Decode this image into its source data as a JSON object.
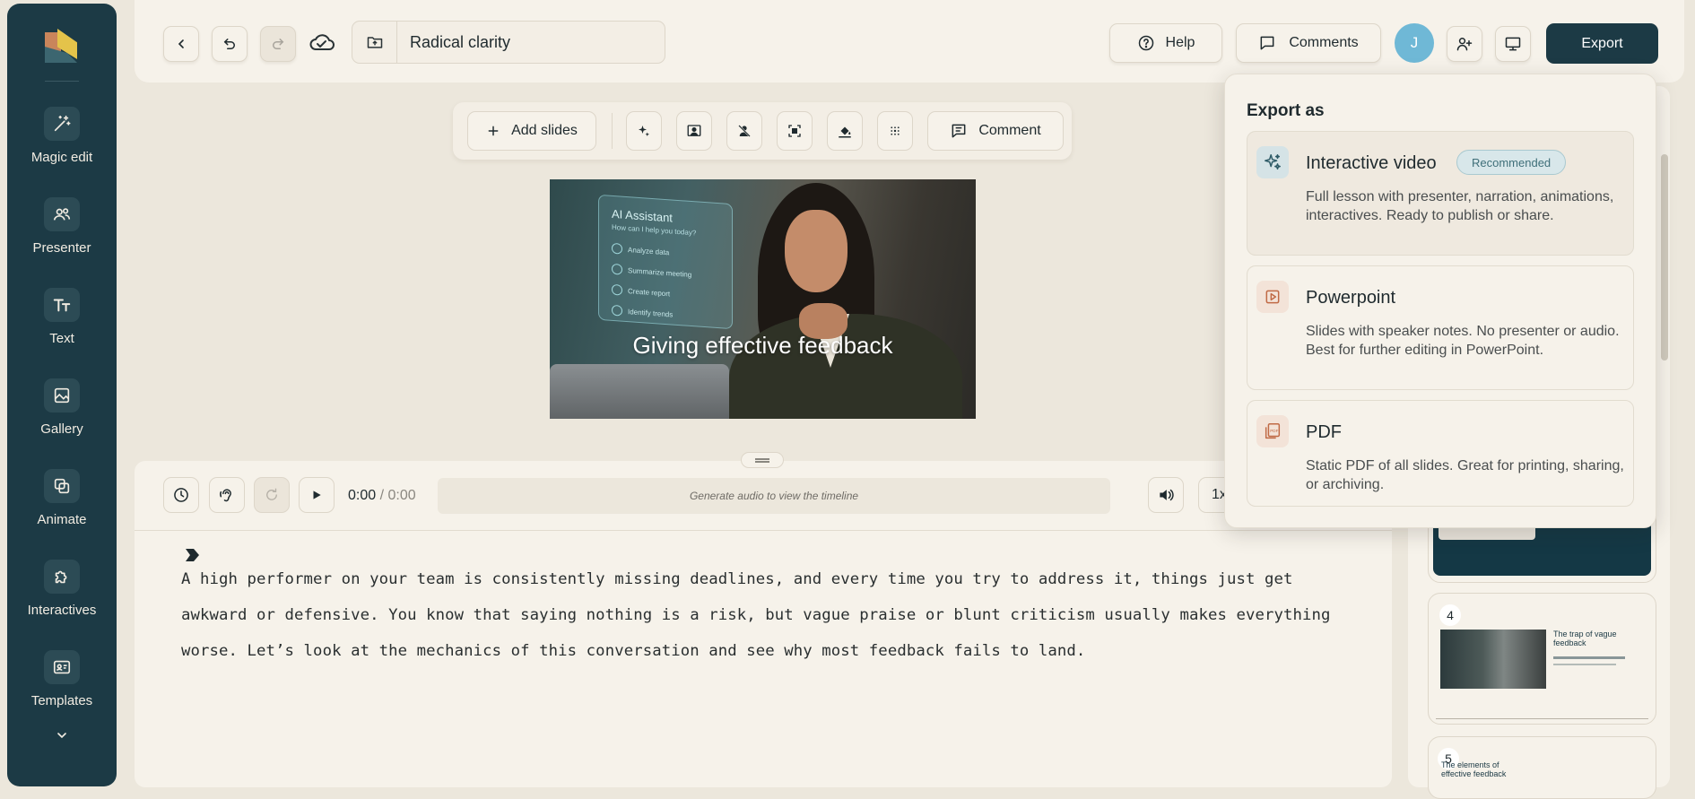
{
  "sidebar": {
    "items": [
      {
        "label": "Magic edit",
        "icon": "magic-wand-icon"
      },
      {
        "label": "Presenter",
        "icon": "people-icon"
      },
      {
        "label": "Text",
        "icon": "text-icon"
      },
      {
        "label": "Gallery",
        "icon": "image-icon"
      },
      {
        "label": "Animate",
        "icon": "layers-icon"
      },
      {
        "label": "Interactives",
        "icon": "puzzle-icon"
      },
      {
        "label": "Templates",
        "icon": "template-icon"
      }
    ]
  },
  "header": {
    "title": "Radical clarity",
    "help_label": "Help",
    "comments_label": "Comments",
    "avatar_initial": "J",
    "export_label": "Export"
  },
  "slide_toolbar": {
    "add_slides_label": "Add slides",
    "comment_label": "Comment"
  },
  "slide": {
    "title": "Giving effective feedback",
    "panel_title": "AI Assistant",
    "panel_subtitle": "How can I help you today?",
    "panel_items": [
      "Analyze data",
      "Summarize meeting",
      "Create report",
      "Identify trends"
    ]
  },
  "player": {
    "current_time": "0:00",
    "total_time": "/ 0:00",
    "timeline_placeholder": "Generate audio to view the timeline",
    "speed": "1x"
  },
  "script": {
    "text": "A high performer on your team is consistently missing deadlines, and every time you try to address it, things just get awkward or defensive. You know that saying nothing is a risk, but vague praise or blunt criticism usually makes everything worse. Let’s look at the mechanics of this conversation and see why most feedback fails to land."
  },
  "slide_panel": {
    "thumbs": [
      {
        "number": "4",
        "title": "The trap of vague feedback"
      },
      {
        "number": "5",
        "title": "The elements of effective feedback"
      }
    ]
  },
  "export_menu": {
    "heading": "Export as",
    "options": [
      {
        "title": "Interactive video",
        "badge": "Recommended",
        "description": "Full lesson with presenter, narration, animations, interactives. Ready to publish or share."
      },
      {
        "title": "Powerpoint",
        "description": "Slides with speaker notes. No presenter or audio. Best for further editing in PowerPoint."
      },
      {
        "title": "PDF",
        "description": "Static PDF of all slides. Great for printing, sharing, or archiving."
      }
    ]
  },
  "colors": {
    "sidebar_bg": "#1c3a45",
    "page_bg": "#ece7dc",
    "panel_bg": "#f6f2ea",
    "export_button": "#1c3a45",
    "avatar": "#6fb8d6",
    "badge": "#d8e7ea"
  }
}
